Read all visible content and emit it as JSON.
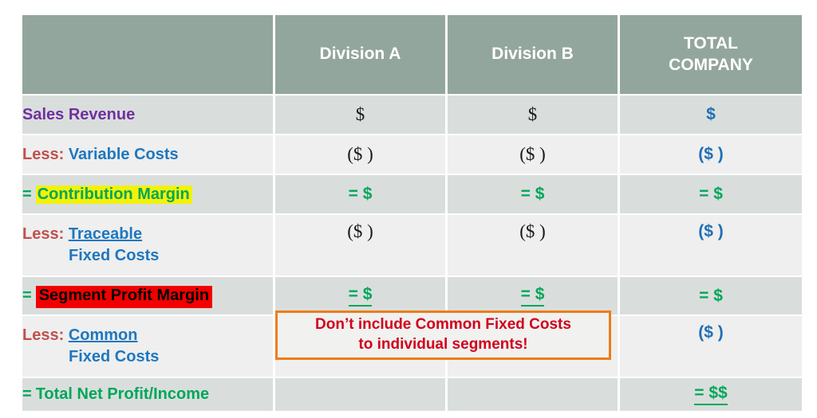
{
  "table": {
    "header": {
      "corner_label": "",
      "columns": [
        "Division A",
        "Division B",
        "TOTAL\nCOMPANY"
      ],
      "col_division_a": "Division A",
      "col_division_b": "Division B",
      "col_total_line1": "TOTAL",
      "col_total_line2": "COMPANY"
    },
    "rows": [
      {
        "id": "sales-revenue",
        "label_full": "Sales Revenue",
        "prefix": "",
        "label_main": "Sales Revenue",
        "label_second_line": "",
        "division_a": "$",
        "division_b": "$",
        "total_company": "$"
      },
      {
        "id": "variable-costs",
        "label_full": "Less: Variable Costs",
        "prefix": "Less:",
        "label_main": "Variable Costs",
        "label_second_line": "",
        "division_a": "($ )",
        "division_b": "($ )",
        "total_company": "($ )"
      },
      {
        "id": "contribution-margin",
        "label_full": "= Contribution Margin",
        "prefix": "=",
        "label_main": "Contribution Margin",
        "label_second_line": "",
        "division_a": "= $",
        "division_b": "= $",
        "total_company": "= $"
      },
      {
        "id": "traceable-fixed-costs",
        "label_full": "Less: Traceable Fixed Costs",
        "prefix": "Less:",
        "label_main": "Traceable",
        "label_second_line": "Fixed Costs",
        "division_a": "($ )",
        "division_b": "($ )",
        "total_company": "($ )"
      },
      {
        "id": "segment-profit-margin",
        "label_full": "= Segment Profit Margin",
        "prefix": "=",
        "label_main": "Segment Profit Margin",
        "label_second_line": "",
        "division_a": "= $",
        "division_b": "= $",
        "total_company": "= $"
      },
      {
        "id": "common-fixed-costs",
        "label_full": "Less: Common Fixed Costs",
        "prefix": "Less:",
        "label_main": "Common",
        "label_second_line": "Fixed Costs",
        "division_a": "",
        "division_b": "",
        "total_company": "($ )"
      },
      {
        "id": "total-net-profit-income",
        "label_full": "= Total Net Profit/Income",
        "prefix": "=",
        "label_main": "Total Net Profit/Income",
        "label_second_line": "",
        "division_a": "",
        "division_b": "",
        "total_company": "= $$"
      }
    ]
  },
  "callout": {
    "line1": "Don’t include Common Fixed Costs",
    "line2": "to individual segments!"
  },
  "colors": {
    "header_background": "#93a69d",
    "row_shade_dark": "#d9dedc",
    "row_shade_light": "#eeefee",
    "purple": "#7030a0",
    "less_red": "#c0504d",
    "blue": "#1f77c0",
    "green": "#00a65a",
    "total_blue": "#1f6fb5",
    "highlight_yellow": "#f2f20a",
    "highlight_red": "#f20000",
    "callout_border_orange": "#ed7d1b",
    "callout_text_red": "#d0021b"
  }
}
